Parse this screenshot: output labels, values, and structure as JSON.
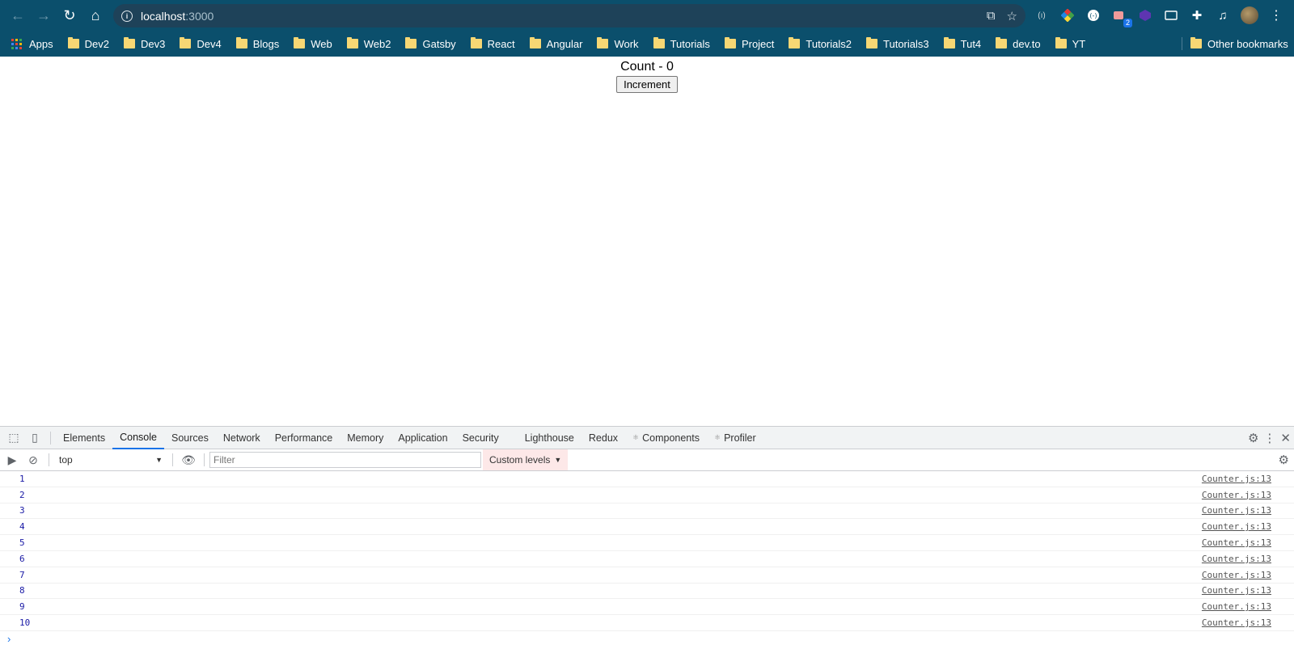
{
  "browser": {
    "url_host": "localhost",
    "url_port": ":3000",
    "extension_badge": "2",
    "bookmarks": [
      "Dev2",
      "Dev3",
      "Dev4",
      "Blogs",
      "Web",
      "Web2",
      "Gatsby",
      "React",
      "Angular",
      "Work",
      "Tutorials",
      "Project",
      "Tutorials2",
      "Tutorials3",
      "Tut4",
      "dev.to",
      "YT"
    ],
    "apps_label": "Apps",
    "other_bookmarks": "Other bookmarks"
  },
  "page": {
    "count_text": "Count - 0",
    "increment_label": "Increment"
  },
  "devtools": {
    "tabs": [
      "Elements",
      "Console",
      "Sources",
      "Network",
      "Performance",
      "Memory",
      "Application",
      "Security",
      "Lighthouse",
      "Redux",
      "Components",
      "Profiler"
    ],
    "active_tab": "Console",
    "context": "top",
    "filter_placeholder": "Filter",
    "levels_label": "Custom levels",
    "logs": [
      {
        "value": "1",
        "source": "Counter.js:13"
      },
      {
        "value": "2",
        "source": "Counter.js:13"
      },
      {
        "value": "3",
        "source": "Counter.js:13"
      },
      {
        "value": "4",
        "source": "Counter.js:13"
      },
      {
        "value": "5",
        "source": "Counter.js:13"
      },
      {
        "value": "6",
        "source": "Counter.js:13"
      },
      {
        "value": "7",
        "source": "Counter.js:13"
      },
      {
        "value": "8",
        "source": "Counter.js:13"
      },
      {
        "value": "9",
        "source": "Counter.js:13"
      },
      {
        "value": "10",
        "source": "Counter.js:13"
      }
    ],
    "prompt_symbol": "›"
  },
  "colors": {
    "chrome_bg": "#0b4f6c",
    "active_tab_underline": "#1a73e8",
    "log_value": "#1a1aa6"
  }
}
